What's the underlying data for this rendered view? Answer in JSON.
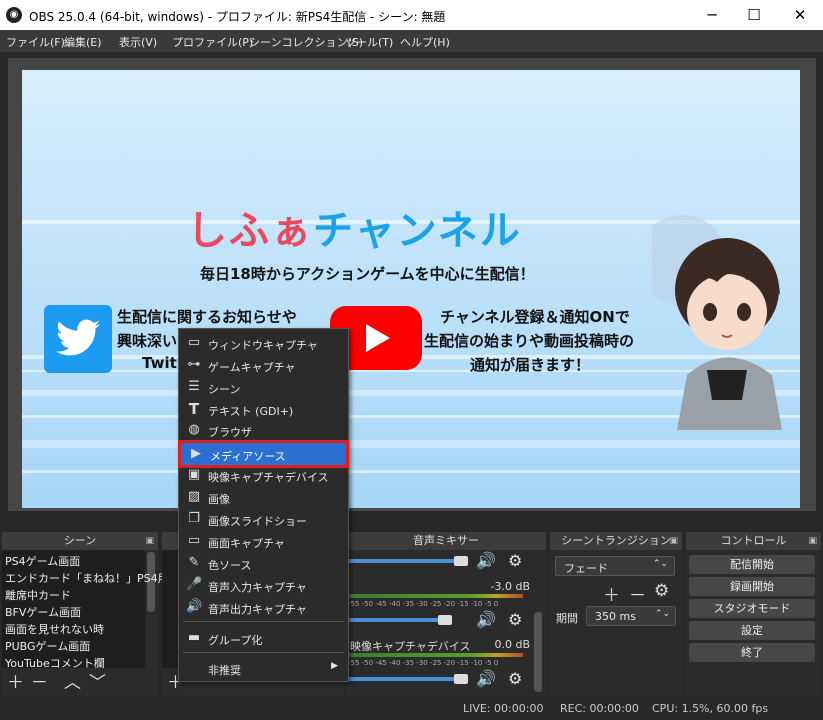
{
  "window": {
    "title": "OBS 25.0.4 (64-bit, windows) - プロファイル: 新PS4生配信 - シーン: 無題",
    "minimize": "─",
    "maximize": "☐",
    "close": "✕"
  },
  "menu": [
    "ファイル(F)",
    "編集(E)",
    "表示(V)",
    "プロファイル(P)",
    "シーンコレクション(S)",
    "ツール(T)",
    "ヘルプ(H)"
  ],
  "preview": {
    "channel_title_a": "しふぁ",
    "channel_title_b": "チャンネル",
    "subtitle": "毎日18時からアクションゲームを中心に生配信！",
    "left_text": [
      "生配信に関するお知らせや",
      "興味深い",
      "Twit"
    ],
    "right_text": [
      "チャンネル登録＆通知ONで",
      "生配信の始まりや動画投稿時の",
      "通知が届きます！"
    ]
  },
  "docks": {
    "scenes": "シーン",
    "mixer": "音声ミキサー",
    "transitions": "シーントランジション",
    "controls": "コントロール"
  },
  "scenes": [
    "PS4ゲーム画面",
    "エンドカード「まねね！」PS4用",
    "離席中カード",
    "BFVゲーム画面",
    "画面を見せれない時",
    "PUBGゲーム画面",
    "YouTubeコメント欄"
  ],
  "mixer": {
    "ch1_db": "-3.0 dB",
    "ch2_name": "映像キャプチャデバイス",
    "ch2_db": "0.0 dB",
    "scale": "-55 -50 -45 -40 -35 -30 -25 -20 -15 -10 -5 0"
  },
  "transition": {
    "type": "フェード",
    "duration_label": "期間",
    "duration": "350 ms"
  },
  "controls": [
    "配信開始",
    "録画開始",
    "スタジオモード",
    "設定",
    "終了"
  ],
  "status": {
    "live": "LIVE: 00:00:00",
    "rec": "REC: 00:00:00",
    "cpu": "CPU: 1.5%, 60.00 fps"
  },
  "context_menu": [
    {
      "label": "ウィンドウキャプチャ",
      "icon": "window-icon"
    },
    {
      "label": "ゲームキャプチャ",
      "icon": "gamepad-icon"
    },
    {
      "label": "シーン",
      "icon": "list-icon"
    },
    {
      "label": "テキスト (GDI+)",
      "icon": "text-icon"
    },
    {
      "label": "ブラウザ",
      "icon": "globe-icon"
    },
    {
      "label": "メディアソース",
      "icon": "play-icon"
    },
    {
      "label": "映像キャプチャデバイス",
      "icon": "camera-icon"
    },
    {
      "label": "画像",
      "icon": "image-icon"
    },
    {
      "label": "画像スライドショー",
      "icon": "slideshow-icon"
    },
    {
      "label": "画面キャプチャ",
      "icon": "monitor-icon"
    },
    {
      "label": "色ソース",
      "icon": "brush-icon"
    },
    {
      "label": "音声入力キャプチャ",
      "icon": "microphone-icon"
    },
    {
      "label": "音声出力キャプチャ",
      "icon": "speaker-icon"
    },
    {
      "label": "グループ化",
      "icon": "folder-icon"
    },
    {
      "label": "非推奨",
      "icon": ""
    }
  ],
  "context_menu_selected": "メディアソース",
  "colors": {
    "accent": "#2b6fd1",
    "highlight_border": "#e02020",
    "twitter": "#1d9bf0",
    "youtube": "#ff0000"
  }
}
